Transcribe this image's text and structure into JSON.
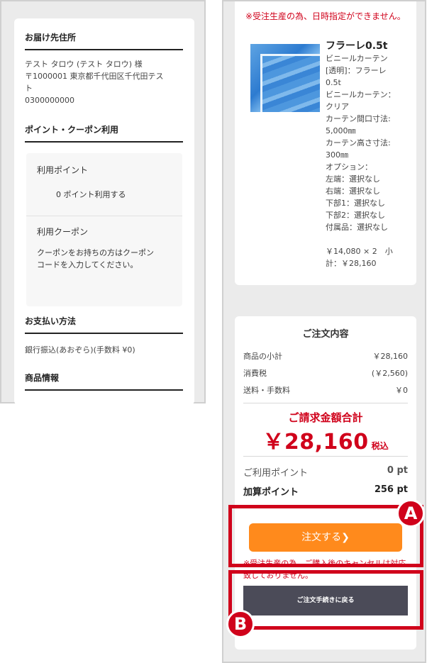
{
  "left": {
    "delivery": {
      "heading": "お届け先住所",
      "name_line": "テスト タロウ (テスト タロウ) 様",
      "address_line1": "〒1000001 東京都千代田区千代田テス",
      "address_line2": "ト",
      "phone": "0300000000"
    },
    "points_coupon": {
      "heading": "ポイント・クーポン利用",
      "points_label": "利用ポイント",
      "points_value": "0 ポイント利用する",
      "coupon_label": "利用クーポン",
      "coupon_text_line1": "クーポンをお持ちの方はクーポン",
      "coupon_text_line2": "コードを入力してください。"
    },
    "payment": {
      "heading": "お支払い方法",
      "method": "銀行振込(あおぞら)(手数料 ¥0)"
    },
    "product_info": {
      "heading": "商品情報"
    }
  },
  "right": {
    "lead_notice": "※受注生産の為、日時指定ができません。",
    "product": {
      "name": "フラーレ0.5t",
      "specs": [
        "ビニールカーテン",
        "[透明]：フラーレ",
        "0.5t",
        "ビニールカーテン：",
        "クリア",
        "カーテン間口寸法:",
        "5,000㎜",
        "カーテン高さ寸法:",
        "300㎜",
        "オプション：",
        "左端：選択なし",
        "右端：選択なし",
        "下部1：選択なし",
        "下部2：選択なし",
        "付属品：選択なし"
      ],
      "price_line1": "￥14,080 × 2　小",
      "price_line2": "計：￥28,160"
    },
    "summary": {
      "title": "ご注文内容",
      "rows": [
        {
          "label": "商品の小計",
          "value": "￥28,160"
        },
        {
          "label": "消費税",
          "value": "(￥2,560)"
        },
        {
          "label": "送料・手数料",
          "value": "￥0"
        }
      ],
      "total_label": "ご請求金額合計",
      "total_amount": "￥28,160",
      "total_tax": "税込",
      "used_points_label": "ご利用ポイント",
      "used_points_value": "0 pt",
      "added_points_label": "加算ポイント",
      "added_points_value": "256 pt"
    },
    "order_button_label": "注文する❯",
    "cancel_notice": "※受注生産の為、ご購入後のキャンセルは対応致しておりません。",
    "back_button_label": "ご注文手続きに戻る"
  },
  "annotations": {
    "a_label": "A",
    "b_label": "B",
    "color": "#d0021b"
  },
  "colors": {
    "accent_orange": "#ff8a1c",
    "alert_red": "#d0021b",
    "back_button": "#4b4b58"
  }
}
